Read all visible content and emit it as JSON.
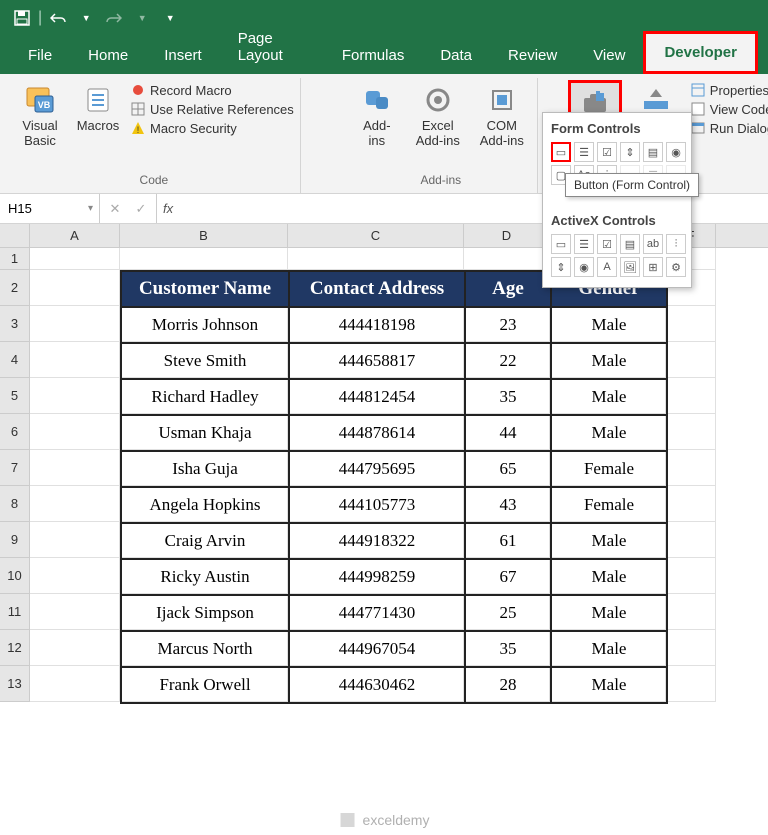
{
  "titlebar": {
    "save": "💾",
    "undo": "↶",
    "redo": "↷"
  },
  "tabs": [
    "File",
    "Home",
    "Insert",
    "Page Layout",
    "Formulas",
    "Data",
    "Review",
    "View",
    "Developer"
  ],
  "active_tab": "Developer",
  "ribbon": {
    "code_group": {
      "visual_basic": "Visual Basic",
      "macros": "Macros",
      "record": "Record Macro",
      "relative": "Use Relative References",
      "security": "Macro Security",
      "label": "Code"
    },
    "addins_group": {
      "addins": "Add-ins",
      "excel": "Excel Add-ins",
      "com": "COM Add-ins",
      "label": "Add-ins"
    },
    "controls_group": {
      "insert": "Insert",
      "design": "Design Mode",
      "properties": "Properties",
      "viewcode": "View Code",
      "rundialog": "Run Dialog"
    }
  },
  "controls_popup": {
    "section1": "Form Controls",
    "section2": "ActiveX Controls",
    "tooltip": "Button (Form Control)"
  },
  "namebox": "H15",
  "columns": {
    "A": 90,
    "B": 168,
    "C": 176,
    "D": 86,
    "E": 116,
    "F": 50
  },
  "rows": [
    1,
    2,
    3,
    4,
    5,
    6,
    7,
    8,
    9,
    10,
    11,
    12,
    13
  ],
  "table": {
    "headers": [
      "Customer Name",
      "Contact Address",
      "Age",
      "Gender"
    ],
    "rows": [
      [
        "Morris Johnson",
        "444418198",
        "23",
        "Male"
      ],
      [
        "Steve Smith",
        "444658817",
        "22",
        "Male"
      ],
      [
        "Richard Hadley",
        "444812454",
        "35",
        "Male"
      ],
      [
        "Usman Khaja",
        "444878614",
        "44",
        "Male"
      ],
      [
        "Isha Guja",
        "444795695",
        "65",
        "Female"
      ],
      [
        "Angela Hopkins",
        "444105773",
        "43",
        "Female"
      ],
      [
        "Craig Arvin",
        "444918322",
        "61",
        "Male"
      ],
      [
        "Ricky Austin",
        "444998259",
        "67",
        "Male"
      ],
      [
        "Ijack Simpson",
        "444771430",
        "25",
        "Male"
      ],
      [
        "Marcus North",
        "444967054",
        "35",
        "Male"
      ],
      [
        "Frank Orwell",
        "444630462",
        "28",
        "Male"
      ]
    ]
  },
  "watermark": "exceldemy"
}
